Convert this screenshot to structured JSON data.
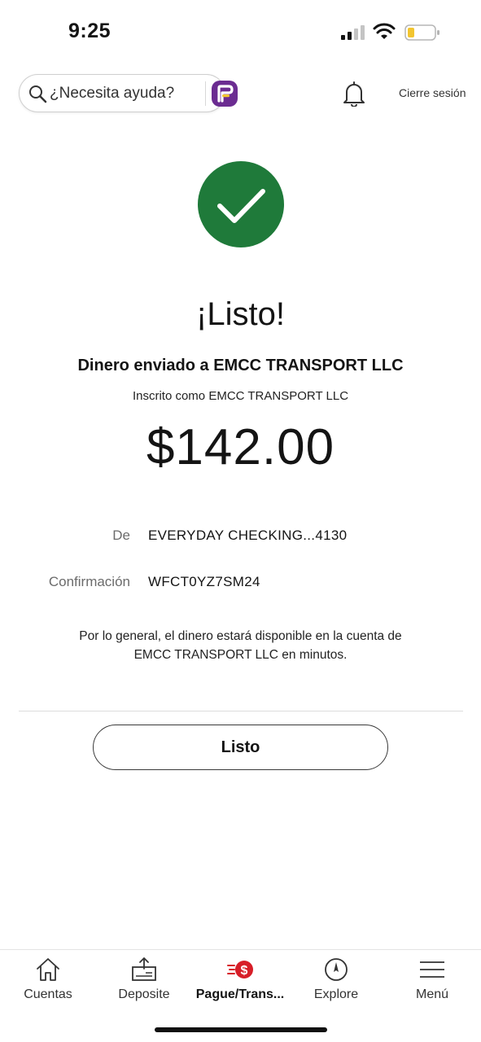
{
  "status_bar": {
    "time": "9:25"
  },
  "header": {
    "search_placeholder": "¿Necesita ayuda?",
    "signout_label": "Cierre sesión"
  },
  "confirmation": {
    "title": "¡Listo!",
    "sent_to": "Dinero enviado a EMCC TRANSPORT LLC",
    "enrolled_as": "Inscrito como EMCC TRANSPORT LLC",
    "amount": "$142.00",
    "details": [
      {
        "label": "De",
        "value": "EVERYDAY CHECKING...4130"
      },
      {
        "label": "Confirmación",
        "value": "WFCT0YZ7SM24"
      }
    ],
    "note_line1": "Por lo general, el dinero estará disponible en la cuenta de",
    "note_line2": "EMCC TRANSPORT LLC en minutos.",
    "done_button": "Listo"
  },
  "bottom_nav": [
    {
      "label": "Cuentas",
      "icon": "home-icon"
    },
    {
      "label": "Deposite",
      "icon": "deposit-icon"
    },
    {
      "label": "Pague/Trans...",
      "icon": "pay-transfer-icon",
      "active": true
    },
    {
      "label": "Explore",
      "icon": "compass-icon"
    },
    {
      "label": "Menú",
      "icon": "menu-icon"
    }
  ],
  "colors": {
    "success_green": "#1f7a3a",
    "brand_red": "#d71e28",
    "fargo_purple": "#6b2c91"
  }
}
